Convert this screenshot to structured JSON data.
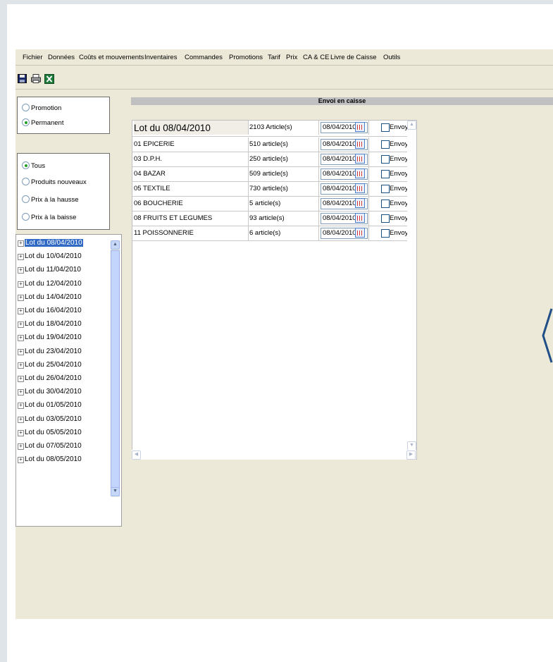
{
  "menu": [
    "Fichier",
    "Données",
    "Coûts et mouvements",
    "Inventaires",
    "Commandes",
    "Promotions",
    "Tarif",
    "Prix",
    "CA & CE",
    "Livre de Caisse",
    "Outils"
  ],
  "toolbar": {
    "icons": [
      "save-icon",
      "print-icon",
      "excel-icon"
    ]
  },
  "filters": {
    "type_options": [
      {
        "label": "Promotion",
        "selected": false
      },
      {
        "label": "Permanent",
        "selected": true
      }
    ],
    "price_options": [
      {
        "label": "Tous",
        "selected": true
      },
      {
        "label": "Produits nouveaux",
        "selected": false
      },
      {
        "label": "Prix à la hausse",
        "selected": false
      },
      {
        "label": "Prix à la baisse",
        "selected": false
      }
    ]
  },
  "tree": {
    "items": [
      "Lot du 08/04/2010",
      "Lot du 10/04/2010",
      "Lot du 11/04/2010",
      "Lot du 12/04/2010",
      "Lot du 14/04/2010",
      "Lot du 16/04/2010",
      "Lot du 18/04/2010",
      "Lot du 19/04/2010",
      "Lot du 23/04/2010",
      "Lot du 25/04/2010",
      "Lot du 26/04/2010",
      "Lot du 30/04/2010",
      "Lot du 01/05/2010",
      "Lot du 03/05/2010",
      "Lot du 05/05/2010",
      "Lot du 07/05/2010",
      "Lot du 08/05/2010"
    ],
    "selected_index": 0
  },
  "panel": {
    "title": "Envoi en caisse"
  },
  "grid": {
    "send_label": "Envoyer",
    "rows": [
      {
        "name": "Lot du 08/04/2010",
        "count": "2103 Article(s)",
        "date": "08/04/2010",
        "checked": false,
        "header": true
      },
      {
        "name": "01 EPICERIE",
        "count": "510 article(s)",
        "date": "08/04/2010",
        "checked": false
      },
      {
        "name": "03 D.P.H.",
        "count": "250 article(s)",
        "date": "08/04/2010",
        "checked": false
      },
      {
        "name": "04 BAZAR",
        "count": "509 article(s)",
        "date": "08/04/2010",
        "checked": false
      },
      {
        "name": "05 TEXTILE",
        "count": "730 article(s)",
        "date": "08/04/2010",
        "checked": false
      },
      {
        "name": "06 BOUCHERIE",
        "count": "5 article(s)",
        "date": "08/04/2010",
        "checked": false
      },
      {
        "name": "08 FRUITS ET LEGUMES",
        "count": "93 article(s)",
        "date": "08/04/2010",
        "checked": false
      },
      {
        "name": "11 POISSONNERIE",
        "count": "6 article(s)",
        "date": "08/04/2010",
        "checked": false
      }
    ]
  }
}
